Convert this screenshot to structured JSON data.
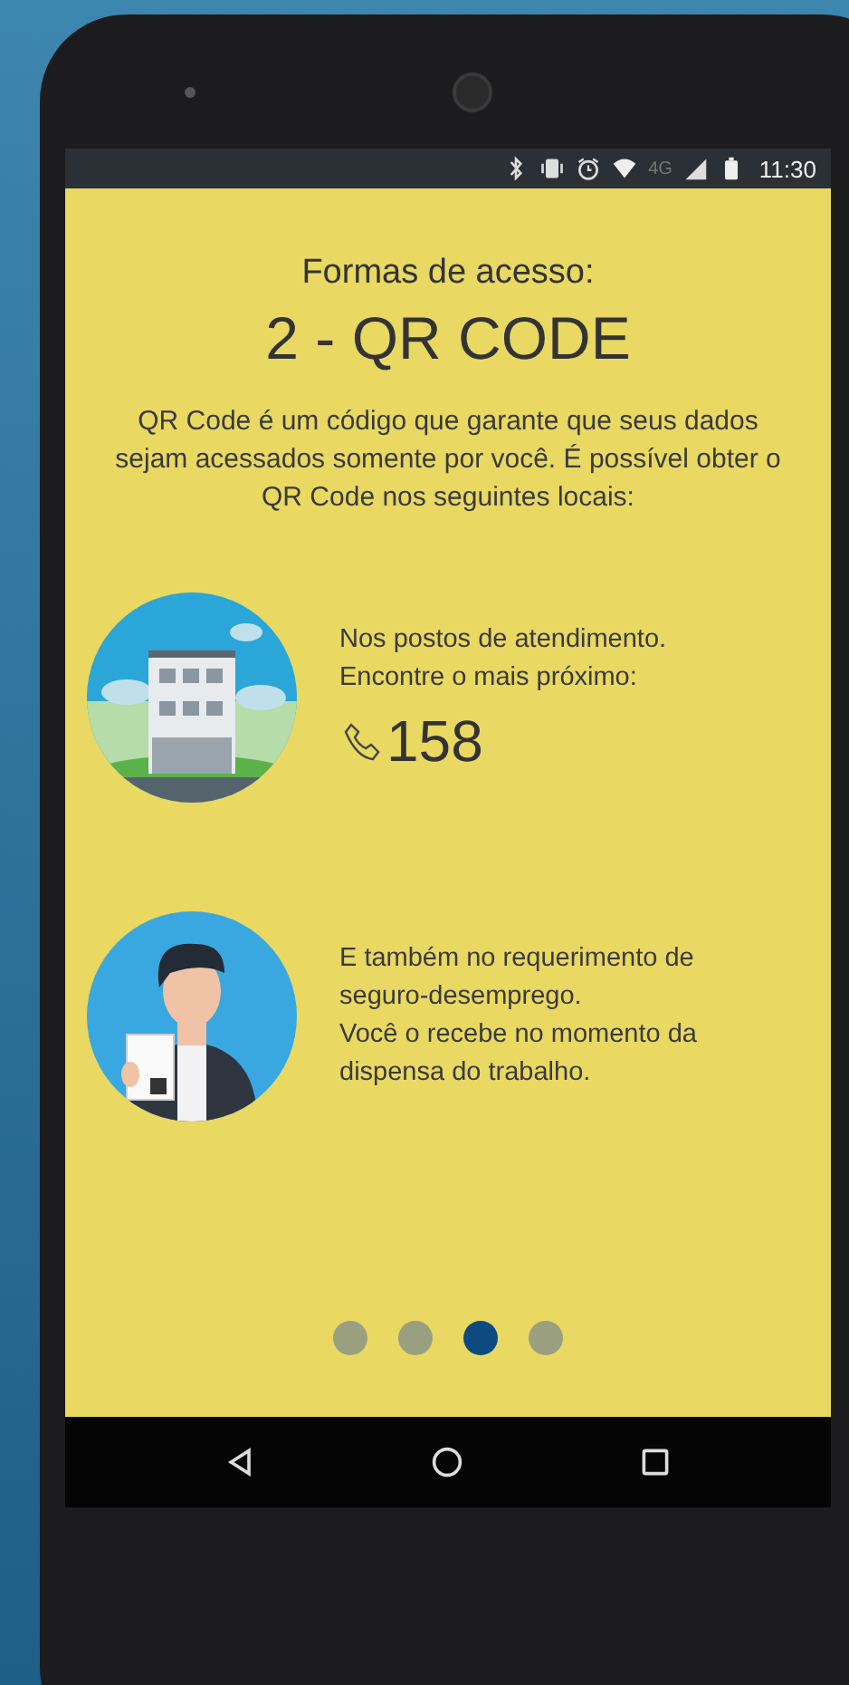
{
  "status_bar": {
    "network": "4G",
    "time": "11:30"
  },
  "heading": "Formas de acesso:",
  "title": "2 - QR CODE",
  "intro": "QR Code é um código que garante que seus dados sejam acessados somente por você. É possível obter o QR Code nos seguintes locais:",
  "items": [
    {
      "kind": "building",
      "paragraphs": [
        "Nos postos de atendimento. Encontre o mais próximo:"
      ],
      "phone": "158"
    },
    {
      "kind": "person",
      "paragraphs": [
        "E também no requerimento de seguro-desemprego.",
        "Você o recebe no momento da dispensa do trabalho."
      ]
    }
  ],
  "pages": [
    {
      "selected": false
    },
    {
      "selected": false
    },
    {
      "selected": true
    },
    {
      "selected": false
    }
  ]
}
